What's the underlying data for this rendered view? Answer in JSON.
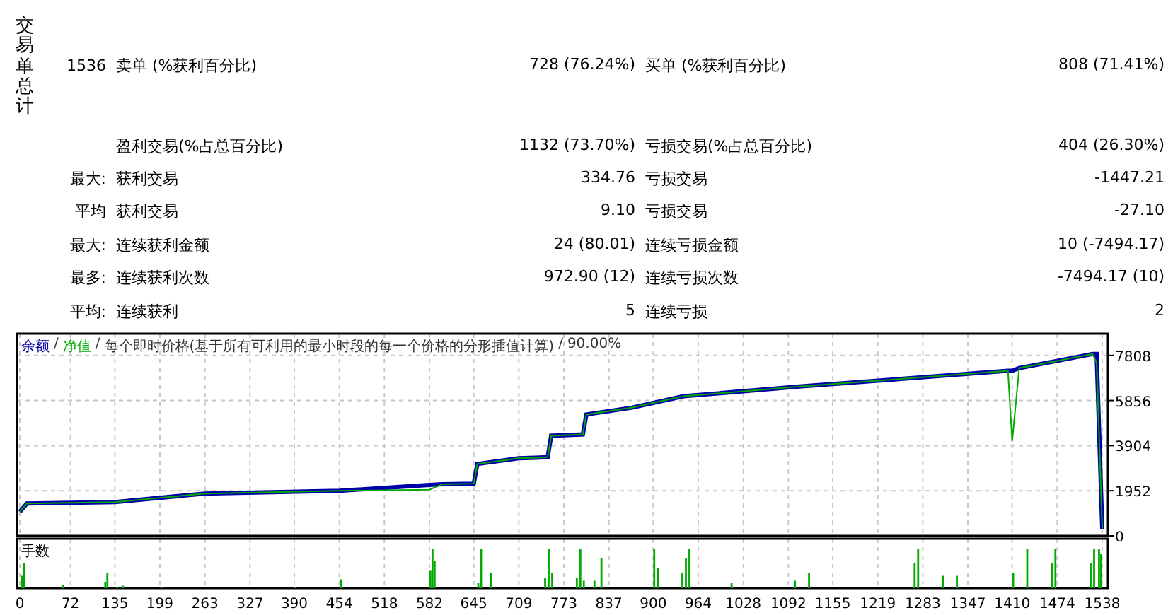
{
  "summary": {
    "side_label": "交易单总计",
    "rows": [
      {
        "prefix": "1536",
        "label": "卖单 (%获利百分比)",
        "value": "728 (76.24%)",
        "label2": "买单 (%获利百分比)",
        "value2": "808 (71.41%)"
      },
      {
        "label": "盈利交易(%占总百分比)",
        "value": "1132 (73.70%)",
        "label2": "亏损交易(%占总百分比)",
        "value2": "404 (26.30%)"
      },
      {
        "prefix": "最大:",
        "label": "获利交易",
        "value": "334.76",
        "label2": "亏损交易",
        "value2": "-1447.21"
      },
      {
        "prefix": "平均",
        "label": "获利交易",
        "value": "9.10",
        "label2": "亏损交易",
        "value2": "-27.10"
      },
      {
        "prefix": "最大:",
        "label": "连续获利金额",
        "value": "24 (80.01)",
        "label2": "连续亏损金额",
        "value2": "10 (-7494.17)"
      },
      {
        "prefix": "最多:",
        "label": "连续获利次数",
        "value": "972.90 (12)",
        "label2": "连续亏损次数",
        "value2": "-7494.17 (10)"
      },
      {
        "prefix": "平均:",
        "label": "连续获利",
        "value": "5",
        "label2": "连续亏损",
        "value2": "2"
      }
    ]
  },
  "chart_panel": {
    "separator": "/",
    "note": "每个即时价格(基于所有可利用的最小时段的每一个价格的分形插值计算)",
    "quality": "90.00%",
    "chart_data": {
      "type": "line",
      "x": [
        0,
        10,
        135,
        263,
        454,
        582,
        600,
        645,
        650,
        709,
        750,
        755,
        800,
        805,
        870,
        943,
        1111,
        1243,
        1404,
        1410,
        1420,
        1472,
        1524,
        1530,
        1538
      ],
      "series": [
        {
          "name": "余额",
          "color": "#0000aa",
          "values": [
            1040,
            1400,
            1460,
            1830,
            1950,
            2200,
            2230,
            2260,
            3110,
            3360,
            3400,
            4330,
            4390,
            5250,
            5550,
            6040,
            6470,
            6770,
            7140,
            7140,
            7260,
            7560,
            7870,
            7870,
            300
          ]
        },
        {
          "name": "净值",
          "color": "#00aa00",
          "values": [
            1040,
            1400,
            1460,
            1830,
            1950,
            2000,
            2230,
            2260,
            3110,
            3360,
            3400,
            4330,
            4390,
            5250,
            5550,
            6040,
            6470,
            6770,
            7140,
            4090,
            7260,
            7560,
            7870,
            7500,
            300
          ]
        }
      ],
      "xlim": [
        0,
        1542
      ],
      "ylim": [
        0,
        8750
      ],
      "grid": true,
      "xticks": [
        0,
        72,
        135,
        199,
        263,
        327,
        390,
        454,
        518,
        582,
        645,
        709,
        773,
        837,
        900,
        964,
        1028,
        1092,
        1155,
        1219,
        1283,
        1347,
        1410,
        1474,
        1538
      ],
      "yticks": [
        0,
        1952,
        3904,
        5856,
        7808
      ]
    }
  },
  "volume_panel": {
    "label": "手数"
  }
}
